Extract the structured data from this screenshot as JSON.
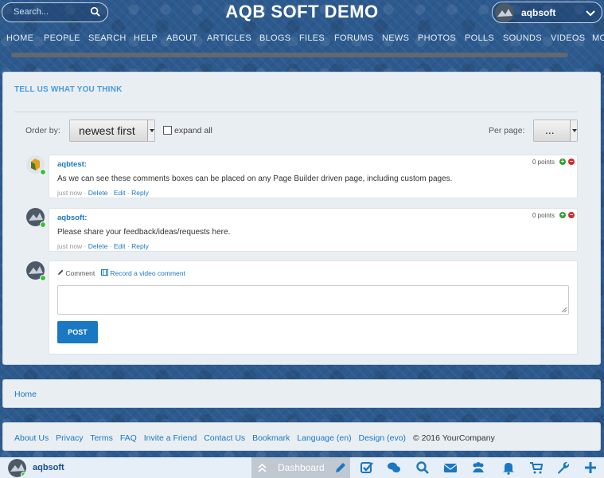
{
  "header": {
    "search_placeholder": "Search...",
    "site_title": "AQB SOFT DEMO",
    "username": "aqbsoft"
  },
  "nav": [
    "HOME",
    "PEOPLE",
    "SEARCH",
    "HELP",
    "ABOUT",
    "ARTICLES",
    "BLOGS",
    "FILES",
    "FORUMS",
    "NEWS",
    "PHOTOS",
    "POLLS",
    "SOUNDS",
    "VIDEOS",
    "MO"
  ],
  "comments_section": {
    "title": "TELL US WHAT YOU THINK",
    "order_by_label": "Order by:",
    "order_by_value": "newest first",
    "expand_all_label": "expand all",
    "per_page_label": "Per page:",
    "per_page_value": "...",
    "comments": [
      {
        "user": "aqbtest:",
        "text": "As we can see these comments boxes can be placed on any Page Builder driven page, including custom pages.",
        "time": "just now",
        "points": "0 points",
        "actions": [
          "Delete",
          "Edit",
          "Reply"
        ]
      },
      {
        "user": "aqbsoft:",
        "text": "Please share your feedback/ideas/requests here.",
        "time": "just now",
        "points": "0 points",
        "actions": [
          "Delete",
          "Edit",
          "Reply"
        ]
      }
    ],
    "new_comment": {
      "tab_comment": "Comment",
      "tab_video": "Record a video comment",
      "post_label": "POST"
    }
  },
  "breadcrumb": {
    "home": "Home"
  },
  "footer": {
    "links": [
      "About Us",
      "Privacy",
      "Terms",
      "FAQ",
      "Invite a Friend",
      "Contact Us",
      "Bookmark",
      "Language (en)",
      "Design (evo)"
    ],
    "copyright": "© 2016 YourCompany"
  },
  "bottom_bar": {
    "username": "aqbsoft",
    "dashboard_label": "Dashboard",
    "icons": [
      "edit-icon",
      "check-icon",
      "chat-icon",
      "search-icon",
      "mail-icon",
      "people-icon",
      "bell-icon",
      "cart-icon",
      "wrench-icon",
      "plus-icon"
    ]
  },
  "colors": {
    "accent": "#1a78c2",
    "section_title": "#4a9bd9",
    "online": "#3bbf3b",
    "vote_up": "#2ca02c",
    "vote_down": "#d62728"
  }
}
